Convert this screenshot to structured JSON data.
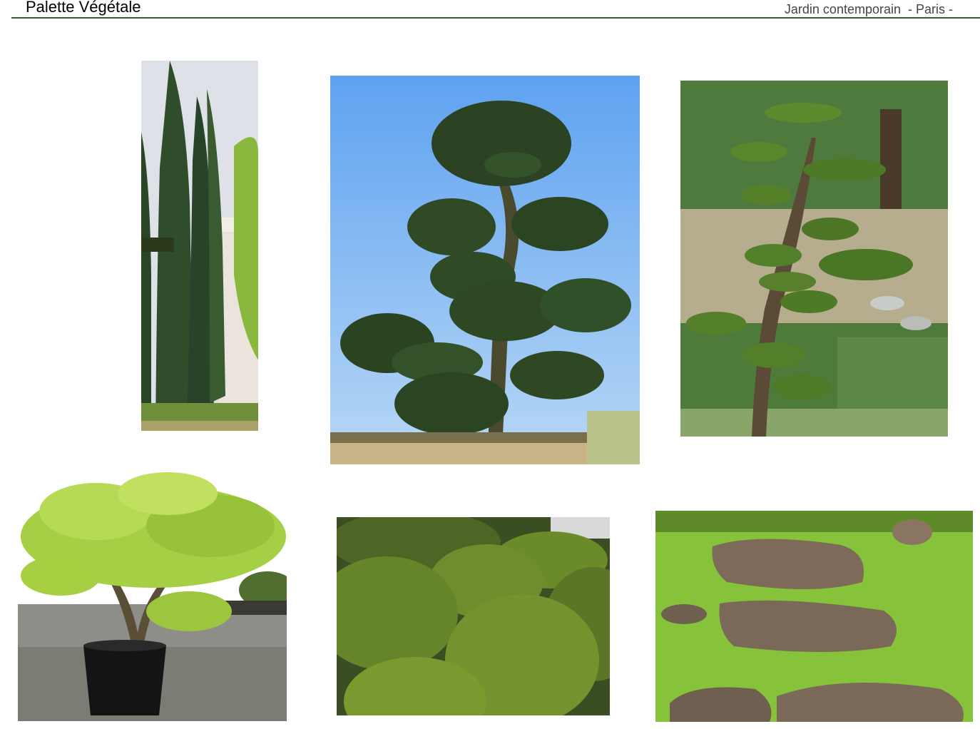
{
  "header": {
    "title": "Palette Végétale",
    "subtitle": "Jardin contemporain  - Paris -"
  },
  "photos": [
    {
      "name": "cypress-columns-photo",
      "colors": {
        "sky": "#dde0e6",
        "tree": "#2e4a2a"
      }
    },
    {
      "name": "cloud-pruned-holly-photo",
      "colors": {
        "sky": "#6aa9f0",
        "tree": "#2f4a26"
      }
    },
    {
      "name": "pond-niwaki-pine-photo",
      "colors": {
        "bg": "#5f8a4a",
        "tree": "#4a6e2c"
      }
    },
    {
      "name": "potted-japanese-maple-photo",
      "colors": {
        "leaves": "#a9d24a",
        "pot": "#151515"
      }
    },
    {
      "name": "boxwood-balls-photo",
      "colors": {
        "ball": "#6f8a2a",
        "bg": "#3b4f20"
      }
    },
    {
      "name": "stepping-stones-moss-photo",
      "colors": {
        "moss": "#8cc63a",
        "stone": "#7a6a5a"
      }
    }
  ]
}
